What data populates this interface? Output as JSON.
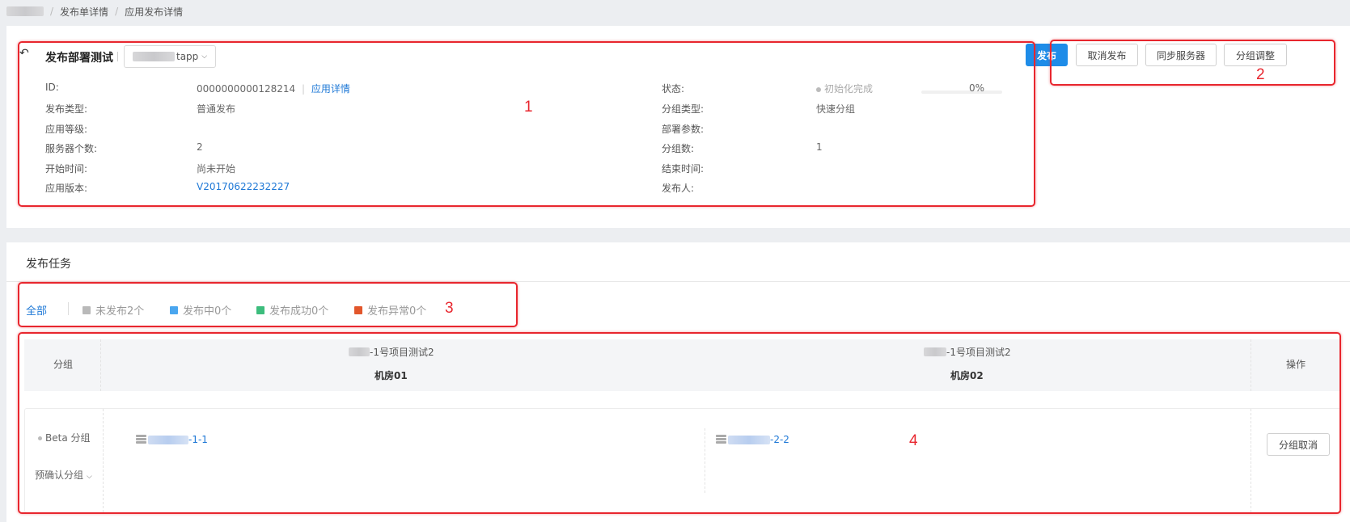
{
  "breadcrumb": [
    "发布单详情",
    "应用发布详情"
  ],
  "header": {
    "title": "发布部署测试",
    "app_select_suffix": "tapp",
    "back_icon": "undo-arrow-icon"
  },
  "info": {
    "id_label": "ID:",
    "id_value": "0000000000128214",
    "app_detail_link": "应用详情",
    "type_label": "发布类型:",
    "type_value": "普通发布",
    "level_label": "应用等级:",
    "server_count_label": "服务器个数:",
    "server_count_value": "2",
    "start_label": "开始时间:",
    "start_value": "尚未开始",
    "version_label": "应用版本:",
    "version_value": "V20170622232227",
    "status_label": "状态:",
    "status_value": "初始化完成",
    "progress_text": "0%",
    "progress_fraction": 0,
    "group_type_label": "分组类型:",
    "group_type_value": "快速分组",
    "deploy_params_label": "部署参数:",
    "group_count_label": "分组数:",
    "group_count_value": "1",
    "end_label": "结束时间:",
    "publisher_label": "发布人:"
  },
  "actions": {
    "publish": "发布",
    "cancel_publish": "取消发布",
    "sync_servers": "同步服务器",
    "adjust_groups": "分组调整"
  },
  "tasks": {
    "title": "发布任务",
    "filters": {
      "all": "全部",
      "unpublished": "未发布2个",
      "publishing": "发布中0个",
      "success": "发布成功0个",
      "error": "发布异常0个"
    },
    "filter_colors": {
      "unpublished": "#b9b9b9",
      "publishing": "#4aa6ef",
      "success": "#3dbd7d",
      "error": "#e2562b"
    },
    "table": {
      "col_group": "分组",
      "col_room1_project": "-1号项目测试2",
      "col_room1_name": "机房01",
      "col_room2_project": "-1号项目测试2",
      "col_room2_name": "机房02",
      "col_ops": "操作"
    },
    "row": {
      "group_name": "Beta 分组",
      "pre_confirm": "预确认分组",
      "server1_suffix": "-1-1",
      "server2_suffix": "-2-2",
      "cancel_group": "分组取消"
    }
  },
  "annotations": [
    "1",
    "2",
    "3",
    "4"
  ],
  "colors": {
    "accent": "#1e8ce8",
    "link": "#1e78d6",
    "annotation": "#e8262e"
  }
}
